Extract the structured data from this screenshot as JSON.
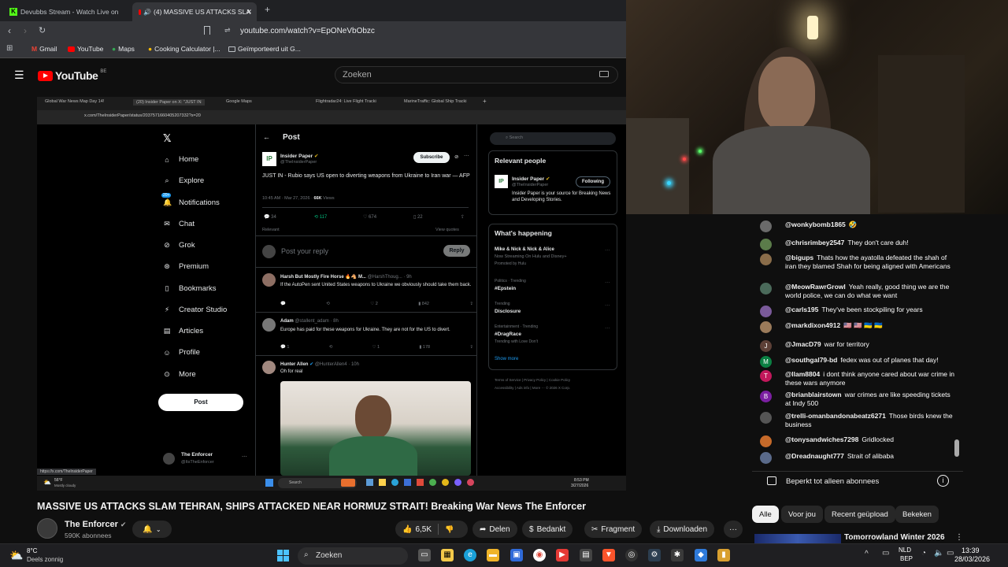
{
  "browser": {
    "tabs": [
      {
        "label": "Devubbs Stream - Watch Live on"
      },
      {
        "label": "(4) MASSIVE US ATTACKS SLA"
      }
    ],
    "new_tab": "+",
    "url": "youtube.com/watch?v=EpONeVbObzc",
    "bookmarks": [
      "Gmail",
      "YouTube",
      "Maps",
      "Cooking Calculator |...",
      "Geïmporteerd uit G..."
    ]
  },
  "yt": {
    "logo_text": "YouTube",
    "region": "BE",
    "search_placeholder": "Zoeken"
  },
  "inner": {
    "tabs": [
      "Global War News Map Day 14!",
      "(20) Insider Paper on X: \"JUST IN",
      "Google Maps",
      "Flightradar24: Live Flight Tracki",
      "MarineTraffic: Global Ship Tracki"
    ],
    "url": "x.com/TheInsiderPaper/status/2037571660405207332?s=20",
    "nav": [
      "Home",
      "Explore",
      "Notifications",
      "Chat",
      "Grok",
      "Premium",
      "Bookmarks",
      "Creator Studio",
      "Articles",
      "Profile",
      "More"
    ],
    "notif_badge": "20+",
    "post_button": "Post",
    "account": {
      "name": "The Enforcer",
      "handle": "@ItsTheEnforcer"
    },
    "post_header": "Post",
    "tweet": {
      "author": "Insider Paper",
      "handle": "@TheInsiderPaper",
      "subscribe": "Subscribe",
      "text": "JUST IN - Rubio says US open to diverting weapons from Ukraine to Iran war — AFP",
      "meta": "10:45 AM · Mar 27, 2026 ·",
      "views_count": "66K",
      "views_label": "Views",
      "stats": [
        "34",
        "117",
        "674",
        "22"
      ],
      "relevant": "Relevant",
      "view_quotes": "View quotes",
      "reply_placeholder": "Post your reply",
      "reply_button": "Reply"
    },
    "replies": [
      {
        "author": "Harsh But Mostly Fire Horse 🔥🐴 M...",
        "handle": "@HarshThoug... · 9h",
        "text": "If the AutoPen sent United States weapons to Ukraine we obviously should take them back.",
        "stats": [
          "",
          "",
          "2",
          "842"
        ]
      },
      {
        "author": "Adam",
        "handle": "@stallent_adam · 8h",
        "text": "Europe has paid for these weapons for Ukraine. They are not for the US to divert.",
        "stats": [
          "1",
          "",
          "1",
          "178"
        ]
      },
      {
        "author": "Hunter Allen",
        "handle": "@HunterAllen4 · 10h",
        "text": "Oh for real",
        "stats": []
      }
    ],
    "right": {
      "search": "Search",
      "relevant_people": "Relevant people",
      "rp_name": "Insider Paper",
      "rp_handle": "@TheInsiderPaper",
      "rp_following": "Following",
      "rp_bio": "Insider Paper is your source for Breaking News and Developing Stories.",
      "whats_happening": "What's happening",
      "trends": [
        {
          "title": "Mike & Nick & Nick & Alice",
          "sub": "Now Streaming On Hulu and Disney+",
          "extra": "Promoted by Hulu"
        },
        {
          "title": "#Epstein",
          "sub": "Politics · Trending",
          "extra": ""
        },
        {
          "title": "Disclosure",
          "sub": "Trending",
          "extra": ""
        },
        {
          "title": "#DragRace",
          "sub": "Entertainment · Trending",
          "extra": "Trending with Love Don't"
        }
      ],
      "show_more": "Show more",
      "footer1": "Terms of Service  |  Privacy Policy  |  Cookie Policy",
      "footer2": "Accessibility  |  Ads info  |  More ···  © 2026 X Corp."
    },
    "status_url": "https://x.com/TheInsiderPaper",
    "taskbar": {
      "weather": "56°F",
      "weather_desc": "Mostly cloudy",
      "search": "Search",
      "time": "8:53 PM",
      "date": "3/27/2026"
    }
  },
  "chat": {
    "messages": [
      {
        "author": "@wonkybomb1865",
        "text": "🤣",
        "color": "#6a6a6a",
        "initial": ""
      },
      {
        "author": "@chrisrimbey2547",
        "text": "They don't care duh!",
        "color": "#5b7c4a",
        "initial": ""
      },
      {
        "author": "@bigups",
        "text": "Thats how the ayatolla defeated the shah of iran they blamed Shah for being aligned with Americans",
        "color": "#8a6d4a",
        "initial": ""
      },
      {
        "author": "@MeowRawrGrowl",
        "text": "Yeah really, good thing we are the world police, we can do what we want",
        "color": "#4a6a5a",
        "initial": ""
      },
      {
        "author": "@carls195",
        "text": "They've been stockpiling for years",
        "color": "#7a5a9a",
        "initial": ""
      },
      {
        "author": "@markdixon4912",
        "text": "🇺🇸 🇺🇸 🇺🇦 🇺🇦",
        "color": "#9a7a5a",
        "initial": ""
      },
      {
        "author": "@JmacD79",
        "text": "war for territory",
        "color": "#5d4037",
        "initial": "J"
      },
      {
        "author": "@southgal79-bd",
        "text": "fedex was out of planes that day!",
        "color": "#0b8043",
        "initial": "M"
      },
      {
        "author": "@llam8804",
        "text": "i dont think anyone cared about war crime in these wars anymore",
        "color": "#c2185b",
        "initial": "T"
      },
      {
        "author": "@brianblairstown",
        "text": "war crimes are like speeding tickets at Indy 500",
        "color": "#7b1fa2",
        "initial": "B"
      },
      {
        "author": "@trelli-omanbandonabeatz6271",
        "text": "Those birds knew the business",
        "color": "#555555",
        "initial": ""
      },
      {
        "author": "@tonysandwiches7298",
        "text": "Gridlocked",
        "color": "#c66a2a",
        "initial": ""
      },
      {
        "author": "@Dreadnaught777",
        "text": "Strait of alibaba",
        "color": "#5a6a8a",
        "initial": ""
      }
    ],
    "footer": "Beperkt tot alleen abonnees"
  },
  "video": {
    "title": "MASSIVE US ATTACKS SLAM TEHRAN, SHIPS ATTACKED NEAR HORMUZ STRAIT! Breaking War News The Enforcer",
    "channel": "The Enforcer",
    "subs": "590K abonnees",
    "likes": "6,5K",
    "share": "Delen",
    "thanks": "Bedankt",
    "clip": "Fragment",
    "download": "Downloaden"
  },
  "chips": [
    "Alle",
    "Voor jou",
    "Recent geüpload",
    "Bekeken"
  ],
  "next_video": "Tomorrowland Winter 2026",
  "taskbar": {
    "temp": "8°C",
    "weather": "Deels zonnig",
    "search": "Zoeken",
    "lang1": "NLD",
    "lang2": "BEP",
    "time": "13:39",
    "date": "28/03/2026"
  }
}
